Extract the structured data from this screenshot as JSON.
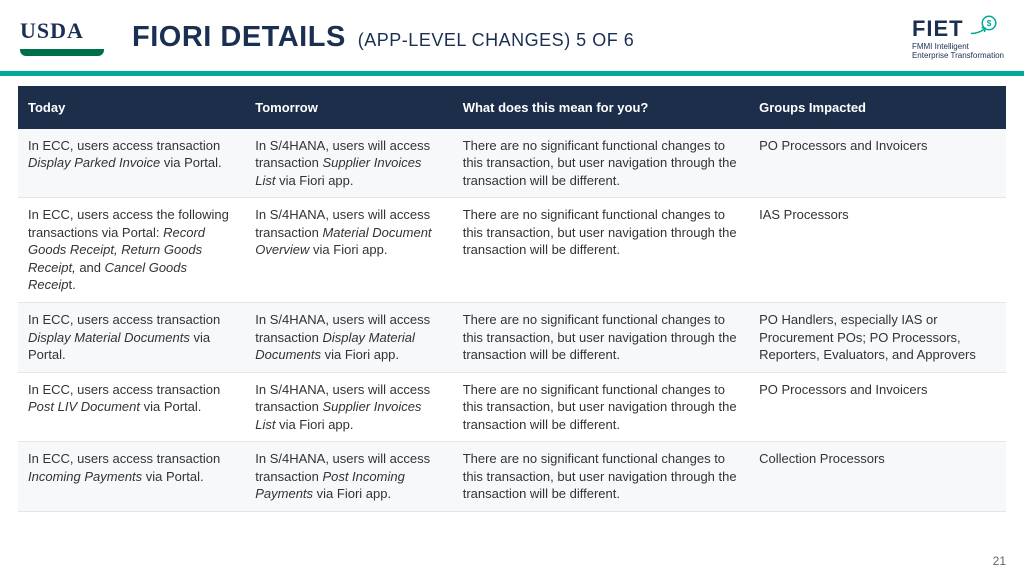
{
  "header": {
    "usda": "USDA",
    "title_main": "FIORI DETAILS",
    "title_sub": "(APP-LEVEL CHANGES) 5 OF 6",
    "fiet": "FIET",
    "fiet_tag1": "FMMI Intelligent",
    "fiet_tag2": "Enterprise Transformation"
  },
  "table": {
    "headers": {
      "today": "Today",
      "tomorrow": "Tomorrow",
      "meaning": "What does this mean for you?",
      "groups": "Groups Impacted"
    },
    "rows": [
      {
        "today_pre": "In ECC, users access transaction ",
        "today_tx": "Display Parked Invoice",
        "today_post": " via Portal.",
        "tomorrow_pre": "In S/4HANA, users will access transaction ",
        "tomorrow_tx": "Supplier Invoices List",
        "tomorrow_post": " via Fiori app.",
        "meaning": "There are no significant functional changes to this transaction, but user navigation through the transaction will be different.",
        "groups": "PO Processors and Invoicers"
      },
      {
        "today_pre": "In ECC, users access the following transactions via Portal: ",
        "today_tx": "Record Goods Receipt, Return Goods Receipt,",
        "today_post": " and ",
        "today_tx2": "Cancel Goods Receip",
        "today_post2": "t.",
        "tomorrow_pre": "In S/4HANA, users will access transaction ",
        "tomorrow_tx": "Material Document Overview",
        "tomorrow_post": " via Fiori app.",
        "meaning": "There are no significant functional changes to this transaction, but user navigation through the transaction will be different.",
        "groups": "IAS Processors"
      },
      {
        "today_pre": "In ECC, users access transaction ",
        "today_tx": "Display Material Documents",
        "today_post": " via Portal.",
        "tomorrow_pre": "In S/4HANA, users will access transaction ",
        "tomorrow_tx": "Display Material Documents",
        "tomorrow_post": " via Fiori app.",
        "meaning": "There are no significant functional changes to this transaction, but user navigation through the transaction will be different.",
        "groups": "PO Handlers, especially IAS or Procurement POs; PO Processors, Reporters, Evaluators, and Approvers"
      },
      {
        "today_pre": "In ECC, users access transaction ",
        "today_tx": "Post LIV Document",
        "today_post": " via Portal.",
        "tomorrow_pre": "In S/4HANA, users will access transaction ",
        "tomorrow_tx": "Supplier Invoices List",
        "tomorrow_post": " via Fiori app.",
        "meaning": "There are no significant functional changes to this transaction, but user navigation through the transaction will be different.",
        "groups": "PO Processors and Invoicers"
      },
      {
        "today_pre": "In ECC, users access transaction ",
        "today_tx": "Incoming Payments",
        "today_post": " via Portal.",
        "tomorrow_pre": "In S/4HANA, users will access transaction ",
        "tomorrow_tx": "Post Incoming Payments",
        "tomorrow_post": " via Fiori app.",
        "meaning": "There are no significant functional changes to this transaction, but user navigation through the transaction will be different.",
        "groups": "Collection Processors"
      }
    ]
  },
  "page_number": "21"
}
